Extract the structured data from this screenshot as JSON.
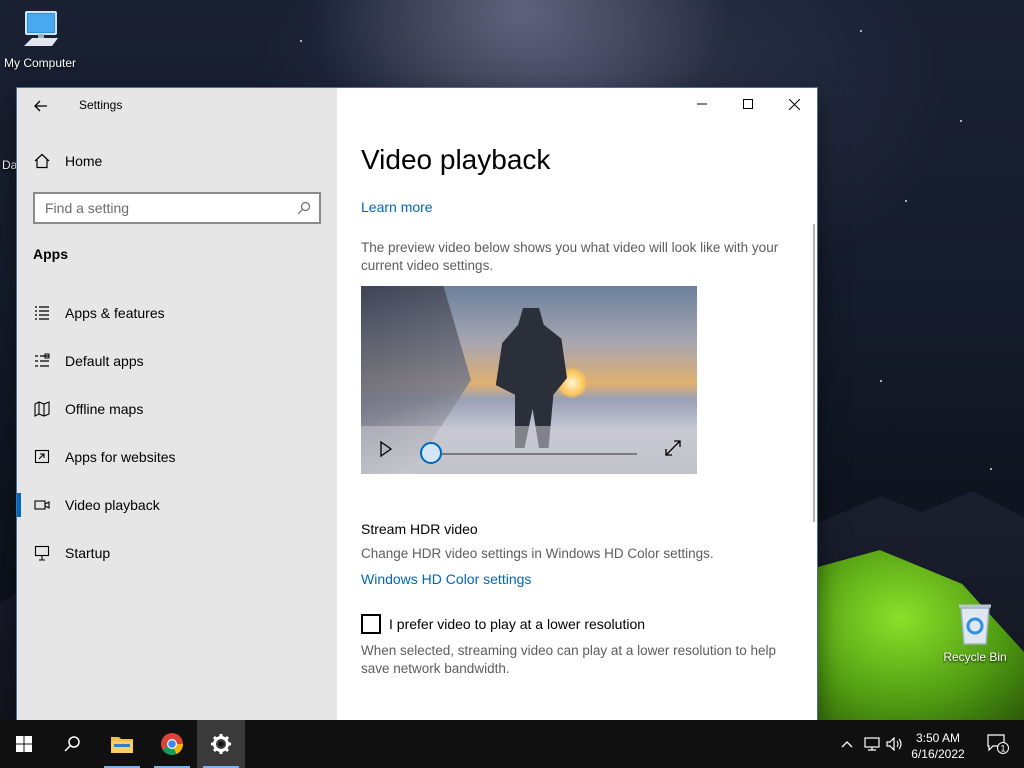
{
  "desktop": {
    "icons": [
      {
        "label": "My Computer"
      },
      {
        "label": "Recycle Bin"
      }
    ],
    "partial_label": "Da"
  },
  "window": {
    "title": "Settings"
  },
  "sidebar": {
    "home_label": "Home",
    "search_placeholder": "Find a setting",
    "section_heading": "Apps",
    "items": [
      {
        "label": "Apps & features",
        "icon": "list-icon"
      },
      {
        "label": "Default apps",
        "icon": "default-apps-icon"
      },
      {
        "label": "Offline maps",
        "icon": "map-icon"
      },
      {
        "label": "Apps for websites",
        "icon": "open-in-app-icon"
      },
      {
        "label": "Video playback",
        "icon": "video-icon",
        "active": true
      },
      {
        "label": "Startup",
        "icon": "startup-icon"
      }
    ]
  },
  "content": {
    "title": "Video playback",
    "learn_more": "Learn more",
    "preview_text": "The preview video below shows you what video will look like with your current video settings.",
    "video_progress_percent": 0,
    "hdr_heading": "Stream HDR video",
    "hdr_text": "Change HDR video settings in Windows HD Color settings.",
    "hdr_link": "Windows HD Color settings",
    "lower_res_label": "I prefer video to play at a lower resolution",
    "lower_res_checked": false,
    "lower_res_text": "When selected, streaming video can play at a lower resolution to help save network bandwidth."
  },
  "taskbar": {
    "clock_time": "3:50 AM",
    "clock_date": "6/16/2022",
    "notification_count": "1"
  },
  "colors": {
    "accent": "#0067c0",
    "link": "#0067b8",
    "sidebar_bg": "#e6e6e6",
    "taskbar_bg": "#101010"
  }
}
